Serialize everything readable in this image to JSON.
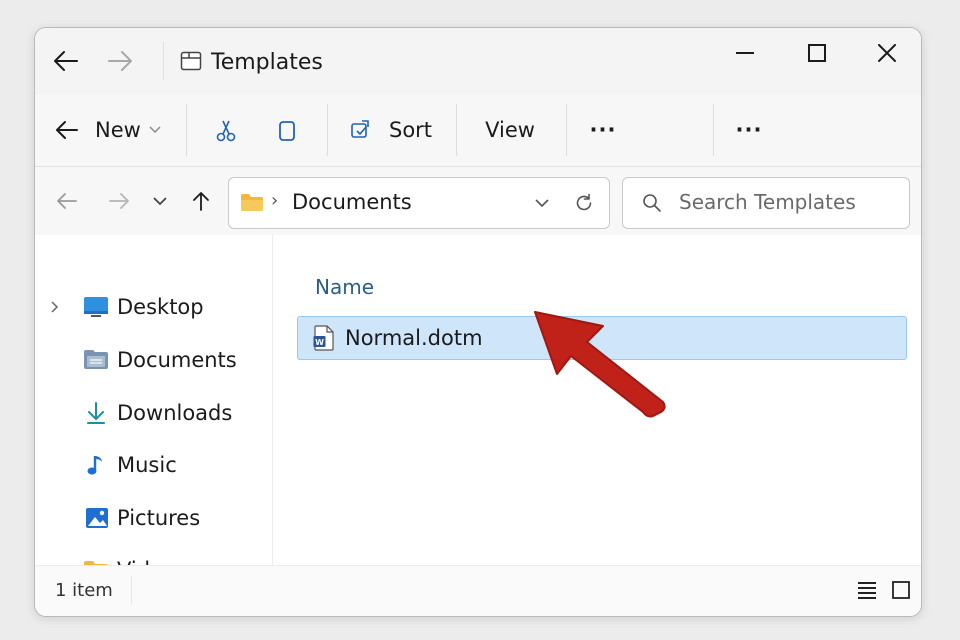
{
  "window": {
    "title": "Templates"
  },
  "toolbar": {
    "new_label": "New",
    "sort_label": "Sort",
    "view_label": "View",
    "more_label": "···",
    "more2_label": "···"
  },
  "address": {
    "path_label": "Documents",
    "separator": "›"
  },
  "search": {
    "placeholder": "Search Templates"
  },
  "sidebar": {
    "items": [
      {
        "label": "Desktop",
        "icon": "desktop-icon"
      },
      {
        "label": "Documents",
        "icon": "documents-icon"
      },
      {
        "label": "Downloads",
        "icon": "downloads-icon"
      },
      {
        "label": "Music",
        "icon": "music-icon"
      },
      {
        "label": "Pictures",
        "icon": "pictures-icon"
      },
      {
        "label": "Videos",
        "icon": "videos-icon"
      }
    ]
  },
  "filelist": {
    "column_name": "Name",
    "files": [
      {
        "name": "Normal.dotm",
        "icon": "word-template-icon",
        "selected": true
      }
    ]
  },
  "status": {
    "item_count": "1 item"
  },
  "colors": {
    "accent": "#0067c0",
    "selection_bg": "#cfe5fa",
    "arrow": "#c0221a",
    "folder": "#f3b73e"
  }
}
